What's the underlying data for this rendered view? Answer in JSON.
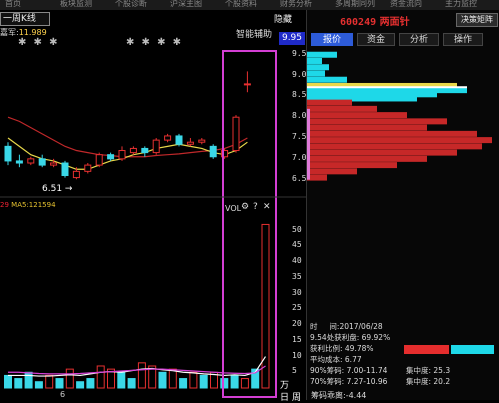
{
  "top_tabs": [
    "首页",
    "板块监测",
    "个股诊断",
    "沪深主图",
    "个股资料",
    "财务分析",
    "多周期同列",
    "资金流向",
    "主力监控"
  ],
  "chart": {
    "period": "一周K线",
    "hide": "隐藏",
    "indicator_prefix": "嘉军:",
    "indicator_value": "11.989",
    "smart_assist": "智能辅助",
    "price_tag": "9.95",
    "low_label": "6.51",
    "vol_prefix": "29",
    "ma_label": "MA5:",
    "ma_value": "121594",
    "vol_title": "VOL",
    "gear": "⚙",
    "question": "?",
    "close": "✕",
    "bottom_date": "6",
    "unit_wan": "万",
    "unit_ri": "日",
    "unit_zhou": "周"
  },
  "right_panel": {
    "stock_code": "600249",
    "stock_name": "两面针",
    "decision_button": "决策矩阵",
    "tabs": [
      "报价",
      "资金",
      "分析",
      "操作"
    ],
    "active_tab": 0,
    "stats": {
      "time_label": "时",
      "time_value": "间:2017/06/28",
      "price_profit": "9.54处获利盘: 69.92%",
      "profit_ratio_label": "获利比例: 49.78%",
      "avg_cost": "平均成本: 6.77",
      "chip90": "90%筹码: 7.00-11.74",
      "conc90": "集中度: 25.3",
      "chip70": "70%筹码: 7.27-10.96",
      "conc70": "集中度: 20.2",
      "cum": "筹码乖离:-4.44"
    },
    "profit_ratio": 0.4978
  },
  "chart_data": [
    {
      "type": "candlestick",
      "title": "",
      "y_ticks": [
        9.5,
        9.0,
        8.5,
        8.0,
        7.5,
        7.0,
        6.5
      ],
      "ylim": [
        6.3,
        9.95
      ],
      "candles": [
        {
          "o": 7.3,
          "c": 6.95,
          "h": 7.4,
          "l": 6.85,
          "up": false
        },
        {
          "o": 6.95,
          "c": 6.9,
          "h": 7.1,
          "l": 6.8,
          "up": false
        },
        {
          "o": 6.9,
          "c": 7.0,
          "h": 7.05,
          "l": 6.85,
          "up": true
        },
        {
          "o": 7.0,
          "c": 6.85,
          "h": 7.1,
          "l": 6.8,
          "up": false
        },
        {
          "o": 6.85,
          "c": 6.9,
          "h": 7.0,
          "l": 6.8,
          "up": true
        },
        {
          "o": 6.9,
          "c": 6.6,
          "h": 6.95,
          "l": 6.55,
          "up": false
        },
        {
          "o": 6.55,
          "c": 6.7,
          "h": 6.8,
          "l": 6.51,
          "up": true
        },
        {
          "o": 6.7,
          "c": 6.85,
          "h": 6.9,
          "l": 6.65,
          "up": true
        },
        {
          "o": 6.85,
          "c": 7.1,
          "h": 7.15,
          "l": 6.8,
          "up": true
        },
        {
          "o": 7.1,
          "c": 7.0,
          "h": 7.15,
          "l": 6.95,
          "up": false
        },
        {
          "o": 7.0,
          "c": 7.2,
          "h": 7.3,
          "l": 6.95,
          "up": true
        },
        {
          "o": 7.15,
          "c": 7.25,
          "h": 7.3,
          "l": 7.1,
          "up": true
        },
        {
          "o": 7.25,
          "c": 7.15,
          "h": 7.3,
          "l": 7.05,
          "up": false
        },
        {
          "o": 7.15,
          "c": 7.45,
          "h": 7.5,
          "l": 7.1,
          "up": true
        },
        {
          "o": 7.45,
          "c": 7.55,
          "h": 7.6,
          "l": 7.4,
          "up": true
        },
        {
          "o": 7.55,
          "c": 7.35,
          "h": 7.6,
          "l": 7.3,
          "up": false
        },
        {
          "o": 7.35,
          "c": 7.4,
          "h": 7.5,
          "l": 7.3,
          "up": true
        },
        {
          "o": 7.4,
          "c": 7.45,
          "h": 7.5,
          "l": 7.35,
          "up": true
        },
        {
          "o": 7.3,
          "c": 7.05,
          "h": 7.35,
          "l": 7.0,
          "up": false
        },
        {
          "o": 7.05,
          "c": 7.2,
          "h": 7.25,
          "l": 7.0,
          "up": true
        },
        {
          "o": 7.2,
          "c": 8.0,
          "h": 8.05,
          "l": 7.15,
          "up": true
        },
        {
          "o": 8.8,
          "c": 8.8,
          "h": 9.1,
          "l": 8.6,
          "up": true
        }
      ],
      "ma_slow": [
        8.0,
        7.9,
        7.75,
        7.6,
        7.45,
        7.3,
        7.2,
        7.15,
        7.1,
        7.08,
        7.05,
        7.05,
        7.05,
        7.08,
        7.1,
        7.12,
        7.15,
        7.18,
        7.2,
        7.25,
        7.35,
        7.5
      ],
      "ma_fast": [
        7.5,
        7.3,
        7.1,
        7.0,
        6.95,
        6.85,
        6.75,
        6.75,
        6.85,
        6.95,
        7.0,
        7.1,
        7.15,
        7.25,
        7.3,
        7.35,
        7.3,
        7.25,
        7.15,
        7.1,
        7.2,
        7.4
      ]
    },
    {
      "type": "bar",
      "title": "VOL",
      "y_ticks": [
        50,
        45,
        40,
        35,
        30,
        25,
        20,
        15,
        10,
        5
      ],
      "ylim": [
        0,
        55
      ],
      "values": [
        4,
        3,
        5,
        2,
        4,
        3,
        6,
        2,
        3,
        7,
        6,
        5,
        3,
        8,
        7,
        5,
        6,
        3,
        5,
        4,
        5,
        3,
        4,
        3,
        6,
        52
      ],
      "up": [
        false,
        false,
        false,
        false,
        true,
        false,
        true,
        false,
        false,
        true,
        true,
        false,
        false,
        true,
        true,
        false,
        true,
        false,
        true,
        false,
        true,
        false,
        false,
        true,
        false,
        true
      ],
      "ma_a": [
        4,
        4,
        4,
        3.8,
        3.8,
        4,
        4.2,
        4,
        4.5,
        5,
        5.2,
        5,
        5.5,
        6,
        6.2,
        5.8,
        5.5,
        5,
        4.8,
        4.5,
        4.3,
        4,
        4.2,
        4,
        5,
        10
      ],
      "ma_b": [
        5,
        5,
        4.8,
        4.6,
        4.5,
        4.5,
        4.5,
        4.6,
        4.8,
        5,
        5.2,
        5.4,
        5.6,
        5.8,
        6,
        6,
        5.8,
        5.6,
        5.4,
        5.2,
        5,
        4.8,
        4.7,
        4.6,
        4.8,
        7
      ]
    },
    {
      "type": "bar",
      "title": "",
      "y_ticks": [
        9.5,
        9.0,
        8.5,
        8.0,
        7.5,
        7.0,
        6.5
      ],
      "ylim": [
        6.3,
        9.95
      ],
      "chip_distribution": [
        {
          "p": 9.5,
          "w": 30,
          "c": "cyan"
        },
        {
          "p": 9.35,
          "w": 15,
          "c": "cyan"
        },
        {
          "p": 9.2,
          "w": 22,
          "c": "cyan"
        },
        {
          "p": 9.05,
          "w": 18,
          "c": "cyan"
        },
        {
          "p": 8.9,
          "w": 40,
          "c": "cyan"
        },
        {
          "p": 8.75,
          "w": 150,
          "c": "yellow"
        },
        {
          "p": 8.65,
          "w": 160,
          "c": "cyan"
        },
        {
          "p": 8.55,
          "w": 130,
          "c": "cyan"
        },
        {
          "p": 8.45,
          "w": 110,
          "c": "cyan"
        },
        {
          "p": 8.35,
          "w": 45,
          "c": "red"
        },
        {
          "p": 8.2,
          "w": 70,
          "c": "red"
        },
        {
          "p": 8.05,
          "w": 100,
          "c": "red"
        },
        {
          "p": 7.9,
          "w": 140,
          "c": "red"
        },
        {
          "p": 7.75,
          "w": 120,
          "c": "red"
        },
        {
          "p": 7.6,
          "w": 170,
          "c": "red"
        },
        {
          "p": 7.45,
          "w": 185,
          "c": "red"
        },
        {
          "p": 7.3,
          "w": 175,
          "c": "red"
        },
        {
          "p": 7.15,
          "w": 150,
          "c": "red"
        },
        {
          "p": 7.0,
          "w": 120,
          "c": "red"
        },
        {
          "p": 6.85,
          "w": 90,
          "c": "red"
        },
        {
          "p": 6.7,
          "w": 50,
          "c": "red"
        },
        {
          "p": 6.55,
          "w": 20,
          "c": "red"
        }
      ]
    }
  ]
}
